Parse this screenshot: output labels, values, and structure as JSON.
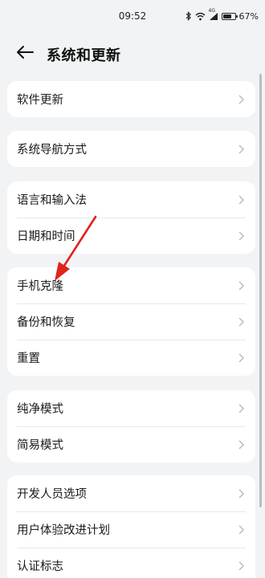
{
  "status_bar": {
    "time": "09:52",
    "network_label": "4G",
    "battery_percent": "67%",
    "battery_level": 0.67
  },
  "header": {
    "title": "系统和更新"
  },
  "groups": [
    {
      "items": [
        {
          "label": "软件更新"
        }
      ]
    },
    {
      "items": [
        {
          "label": "系统导航方式"
        }
      ]
    },
    {
      "items": [
        {
          "label": "语言和输入法"
        },
        {
          "label": "日期和时间"
        }
      ]
    },
    {
      "items": [
        {
          "label": "手机克隆"
        },
        {
          "label": "备份和恢复"
        },
        {
          "label": "重置"
        }
      ]
    },
    {
      "items": [
        {
          "label": "纯净模式"
        },
        {
          "label": "简易模式"
        }
      ]
    },
    {
      "items": [
        {
          "label": "开发人员选项"
        },
        {
          "label": "用户体验改进计划"
        },
        {
          "label": "认证标志"
        }
      ]
    }
  ],
  "icons": {
    "back": "arrow-left-icon",
    "chevron": "chevron-right-icon",
    "bluetooth": "bluetooth-icon",
    "wifi": "wifi-icon",
    "signal": "signal-icon",
    "battery": "battery-icon"
  },
  "colors": {
    "background": "#f1f3f5",
    "card": "#ffffff",
    "annotation": "#e0241c"
  }
}
